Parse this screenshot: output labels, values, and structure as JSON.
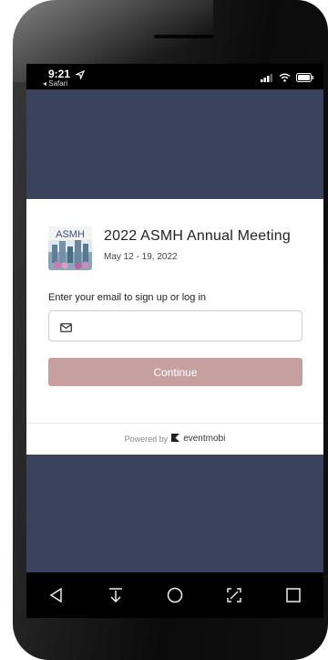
{
  "status_bar": {
    "time": "9:21",
    "back_app": "◂ Safari"
  },
  "event": {
    "title": "2022 ASMH Annual Meeting",
    "dates": "May 12 - 19, 2022",
    "logo_text": "ASMH"
  },
  "login": {
    "email_label": "Enter your email to sign up or log in",
    "email_value": "",
    "email_placeholder": "",
    "continue_label": "Continue"
  },
  "footer": {
    "powered_by": "Powered by",
    "brand": "eventmobi"
  },
  "colors": {
    "screen_bg": "#3a425c",
    "button_bg": "#c6a09e",
    "card_bg": "#ffffff"
  }
}
